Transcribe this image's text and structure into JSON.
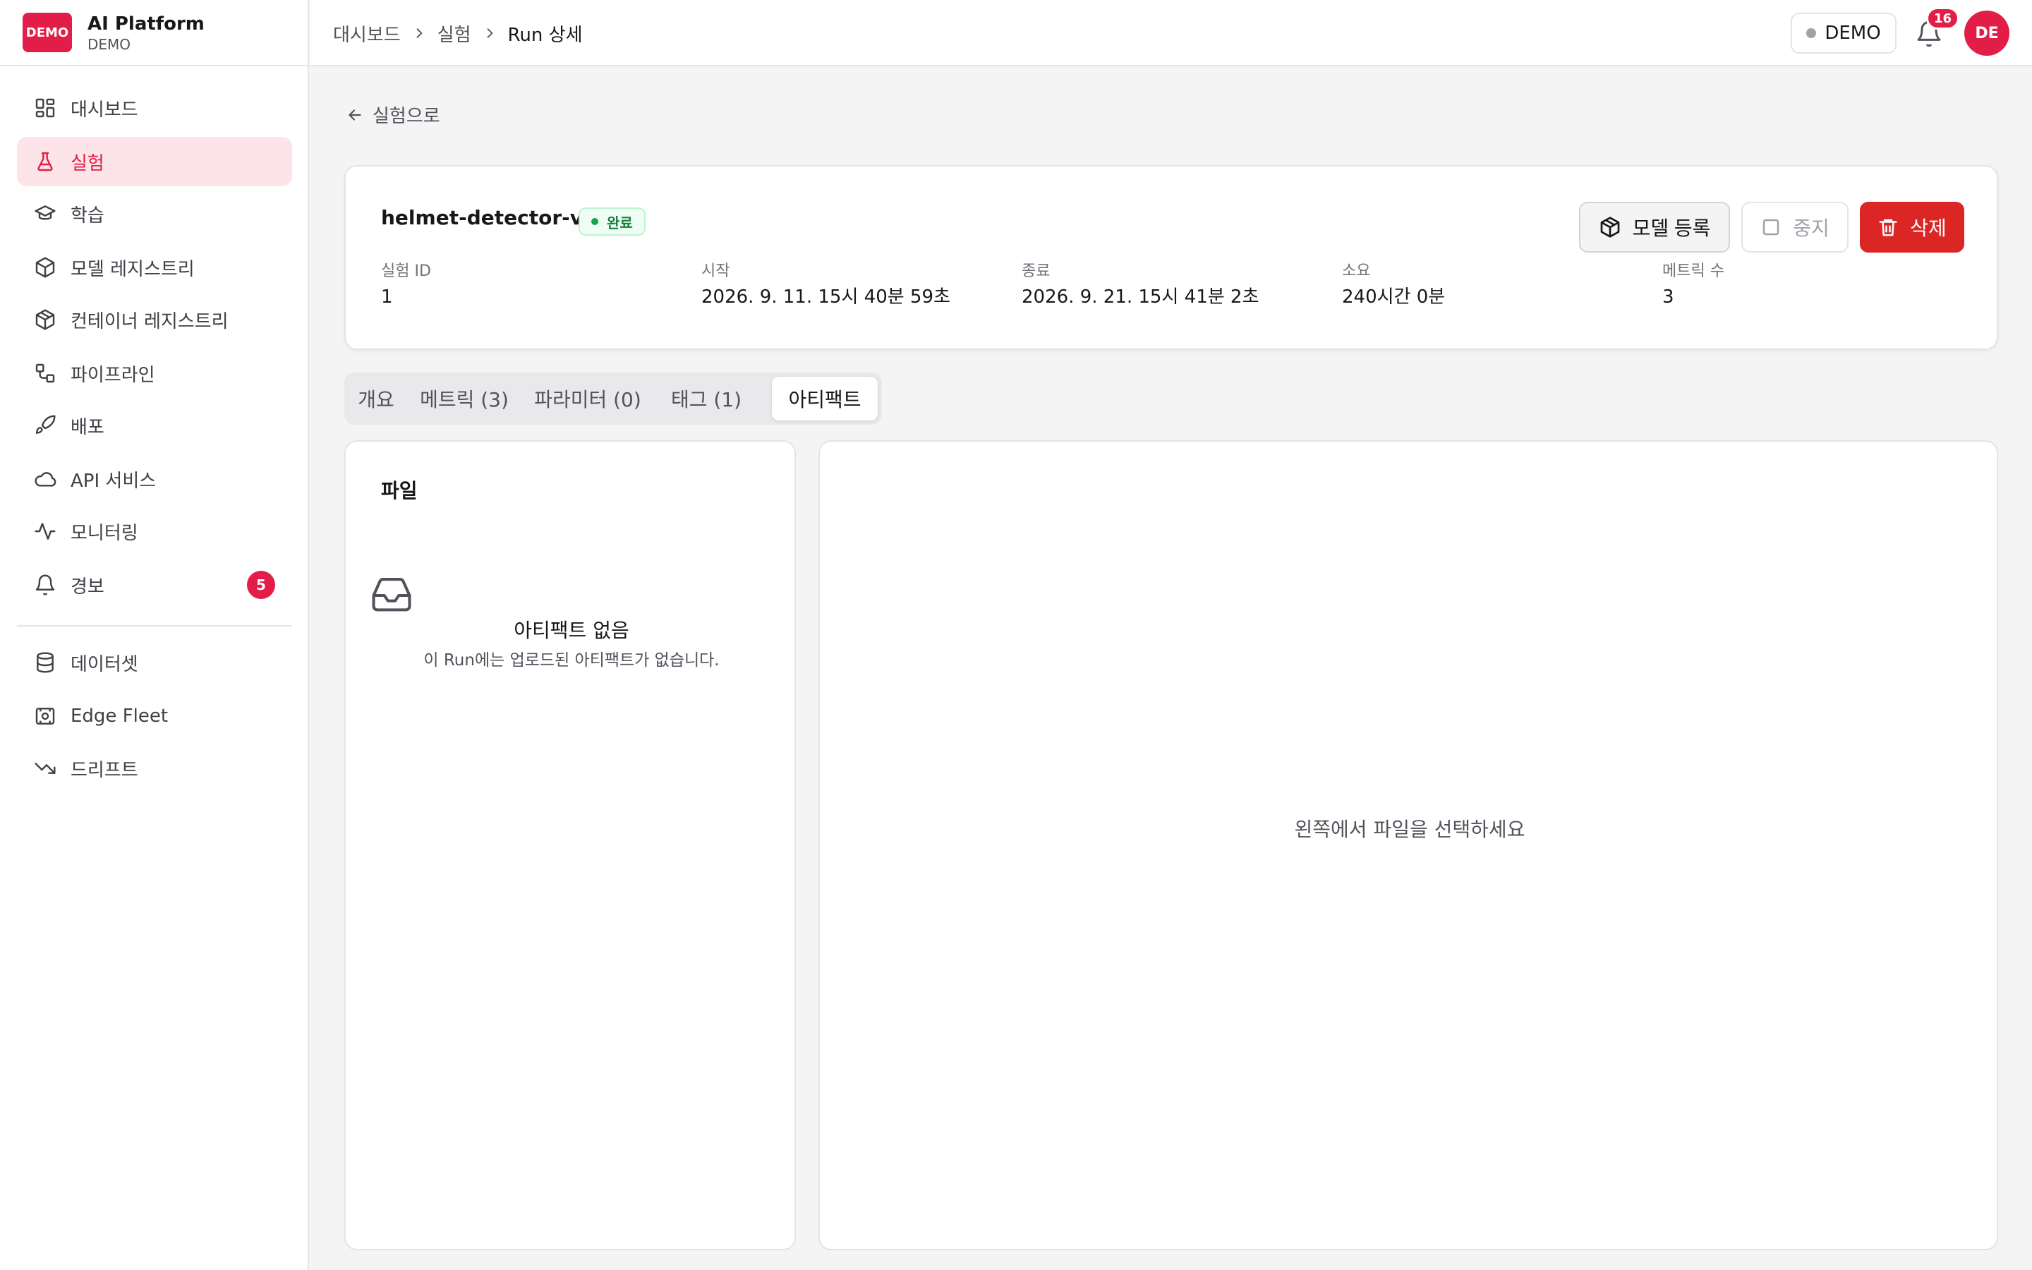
{
  "brand": {
    "logo_text": "DEMO",
    "name": "AI Platform",
    "subtitle": "DEMO",
    "accent": "#e11d48"
  },
  "sidebar": {
    "items": [
      {
        "label": "대시보드",
        "icon": "dashboard-icon"
      },
      {
        "label": "실험",
        "icon": "flask-icon",
        "active": true
      },
      {
        "label": "학습",
        "icon": "graduation-cap-icon"
      },
      {
        "label": "모델 레지스트리",
        "icon": "box-icon"
      },
      {
        "label": "컨테이너 레지스트리",
        "icon": "container-icon"
      },
      {
        "label": "파이프라인",
        "icon": "pipeline-icon"
      },
      {
        "label": "배포",
        "icon": "rocket-icon"
      },
      {
        "label": "API 서비스",
        "icon": "cloud-icon"
      },
      {
        "label": "모니터링",
        "icon": "activity-icon"
      },
      {
        "label": "경보",
        "icon": "bell-icon",
        "badge": "5"
      },
      {
        "label": "데이터셋",
        "icon": "database-icon"
      },
      {
        "label": "Edge Fleet",
        "icon": "chip-icon"
      },
      {
        "label": "드리프트",
        "icon": "trending-down-icon"
      }
    ]
  },
  "header": {
    "breadcrumb": [
      "대시보드",
      "실험",
      "Run 상세"
    ],
    "env_label": "DEMO",
    "notification_count": "16",
    "avatar_initials": "DE"
  },
  "back_link": "실험으로",
  "run": {
    "name": "helmet-detector-v2",
    "status": "완료",
    "status_color": "#16a34a",
    "meta": [
      {
        "label": "실험 ID",
        "value": "1"
      },
      {
        "label": "시작",
        "value": "2026. 9. 11. 15시 40분 59초"
      },
      {
        "label": "종료",
        "value": "2026. 9. 21. 15시 41분 2초"
      },
      {
        "label": "소요",
        "value": "240시간 0분"
      },
      {
        "label": "메트릭 수",
        "value": "3"
      }
    ],
    "actions": {
      "register": "모델 등록",
      "stop": "중지",
      "delete": "삭제"
    }
  },
  "tabs": [
    {
      "label": "개요"
    },
    {
      "label": "메트릭 (3)"
    },
    {
      "label": "파라미터 (0)"
    },
    {
      "label": "태그 (1)"
    },
    {
      "label": "아티팩트",
      "active": true
    }
  ],
  "files": {
    "title": "파일",
    "empty_title": "아티팩트 없음",
    "empty_desc": "이 Run에는 업로드된 아티팩트가 없습니다."
  },
  "preview": {
    "hint": "왼쪽에서 파일을 선택하세요"
  }
}
